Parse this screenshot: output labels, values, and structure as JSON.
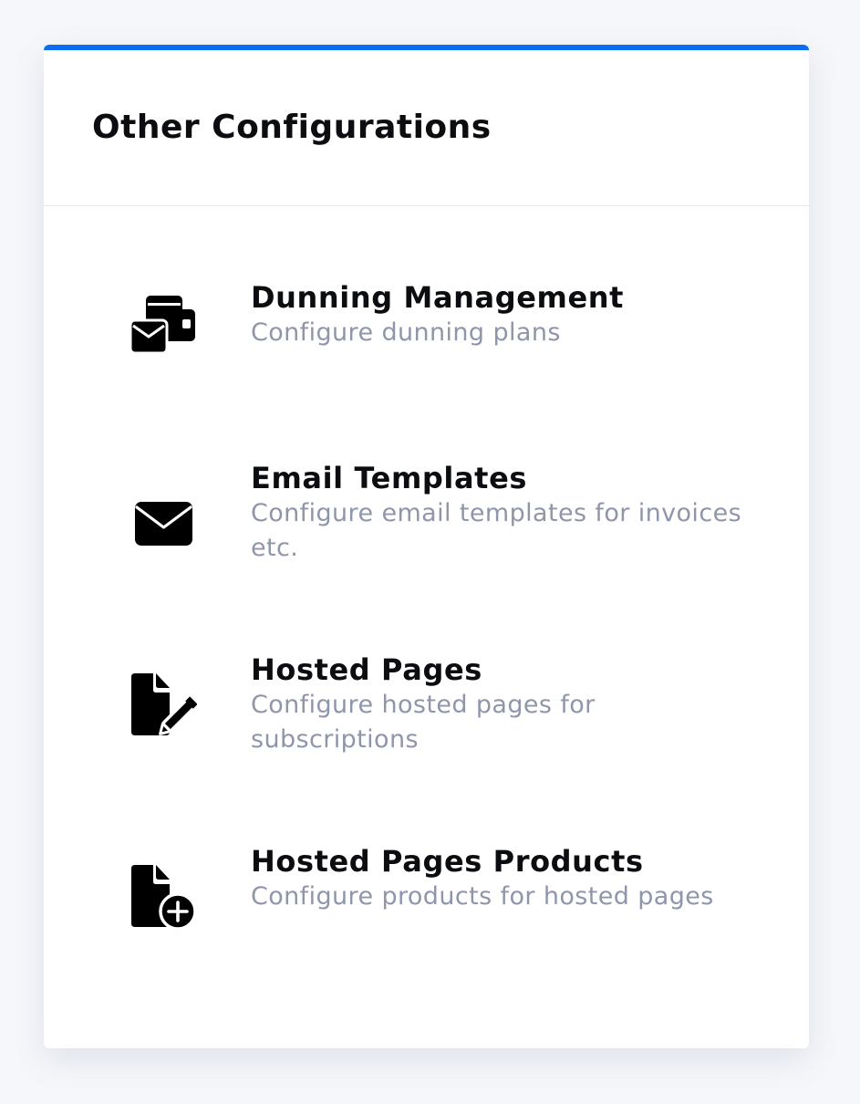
{
  "card": {
    "title": "Other Configurations",
    "accent_color": "#0b6ef2"
  },
  "items": [
    {
      "icon": "dunning-wallet-mail-icon",
      "title": "Dunning Management",
      "description": "Configure dunning plans"
    },
    {
      "icon": "envelope-icon",
      "title": "Email Templates",
      "description": "Configure email templates for invoices etc."
    },
    {
      "icon": "file-pen-icon",
      "title": "Hosted Pages",
      "description": "Configure hosted pages for subscriptions"
    },
    {
      "icon": "file-plus-icon",
      "title": "Hosted Pages Products",
      "description": "Configure products for hosted pages"
    }
  ]
}
